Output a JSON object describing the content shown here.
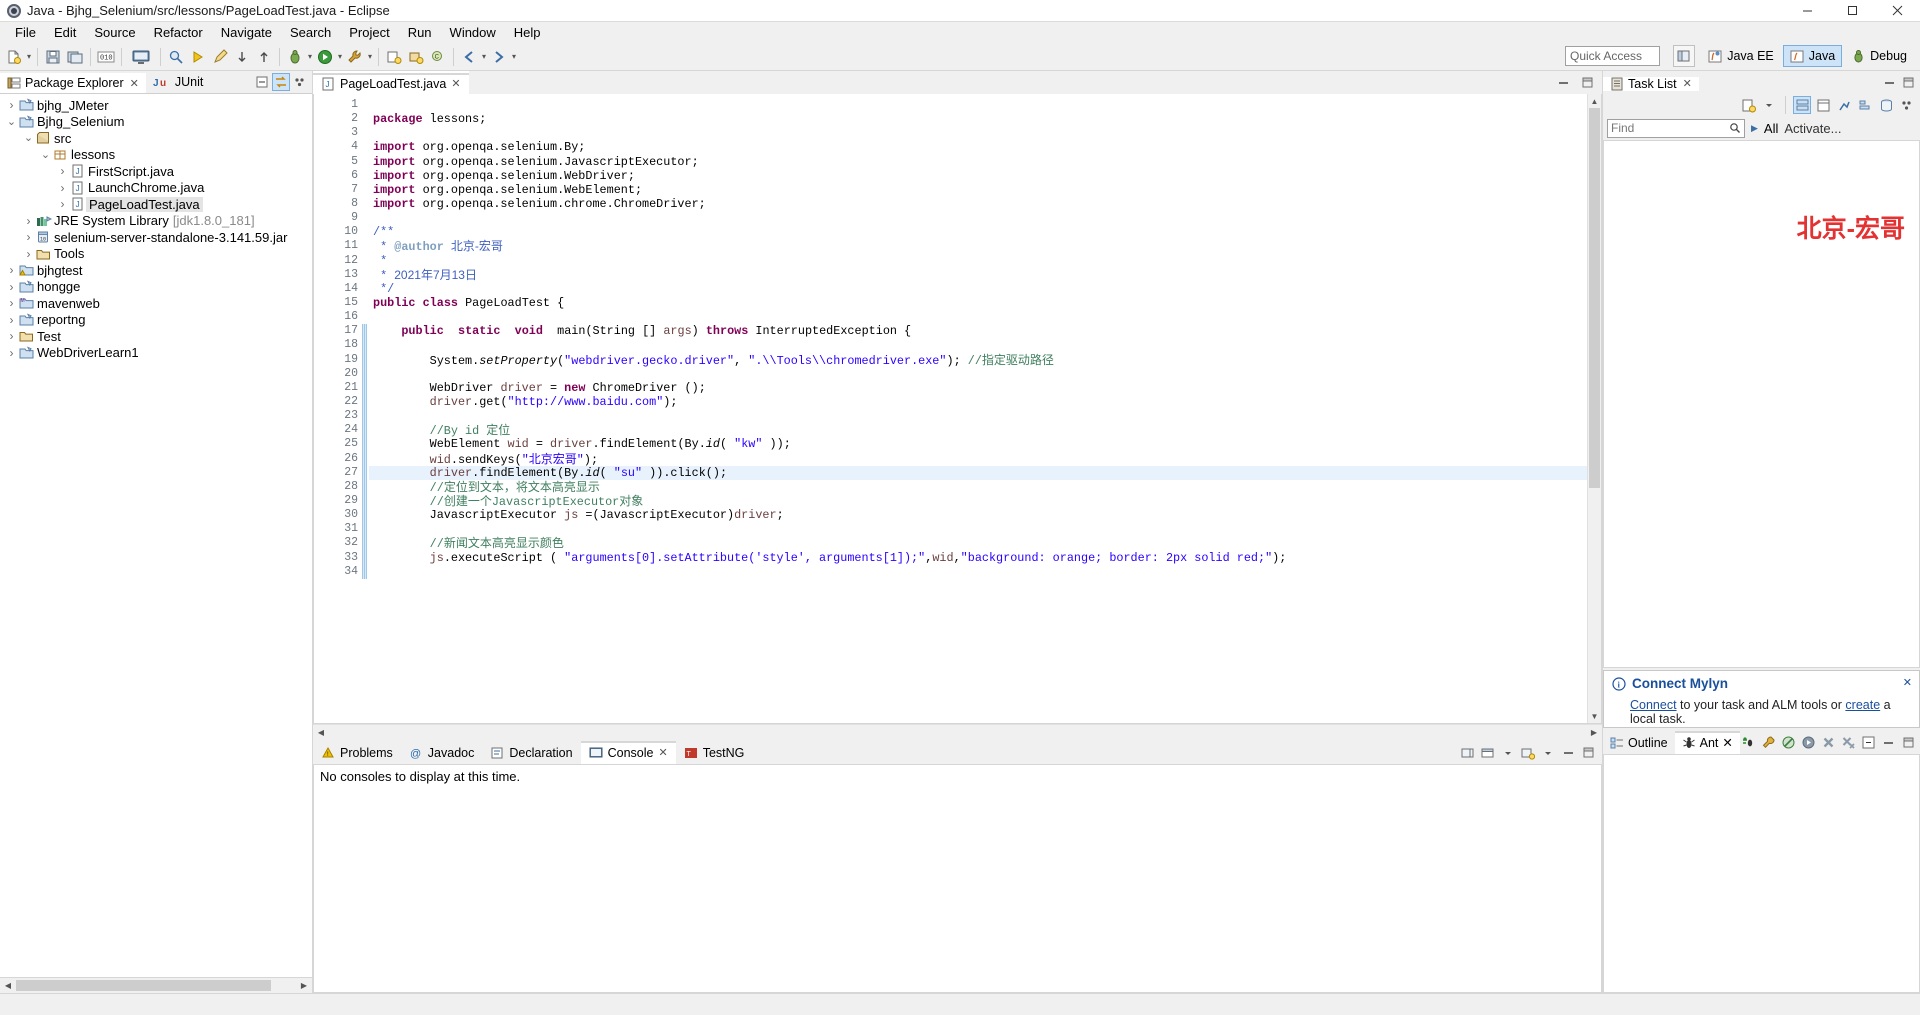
{
  "window": {
    "title": "Java - Bjhg_Selenium/src/lessons/PageLoadTest.java - Eclipse",
    "minimize": "—",
    "maximize": "□",
    "close": "✕"
  },
  "menu": [
    "File",
    "Edit",
    "Source",
    "Refactor",
    "Navigate",
    "Search",
    "Project",
    "Run",
    "Window",
    "Help"
  ],
  "toolbar": {
    "quick_access_placeholder": "Quick Access",
    "perspectives": [
      {
        "label": "Java EE",
        "active": false
      },
      {
        "label": "Java",
        "active": true
      },
      {
        "label": "Debug",
        "active": false
      }
    ]
  },
  "left_panel": {
    "tabs": [
      {
        "label": "Package Explorer",
        "active": true,
        "closable": true
      },
      {
        "label": "JUnit",
        "active": false,
        "closable": false
      }
    ],
    "tree": [
      {
        "label": "bjhg_JMeter",
        "depth": 0,
        "arrow": "collapsed",
        "icon": "project-icon",
        "selected": false
      },
      {
        "label": "Bjhg_Selenium",
        "depth": 0,
        "arrow": "expanded",
        "icon": "project-icon",
        "selected": false
      },
      {
        "label": "src",
        "depth": 1,
        "arrow": "expanded",
        "icon": "source-folder-icon",
        "selected": false
      },
      {
        "label": "lessons",
        "depth": 2,
        "arrow": "expanded",
        "icon": "package-icon",
        "selected": false
      },
      {
        "label": "FirstScript.java",
        "depth": 3,
        "arrow": "collapsed",
        "icon": "java-file-icon",
        "selected": false
      },
      {
        "label": "LaunchChrome.java",
        "depth": 3,
        "arrow": "collapsed",
        "icon": "java-file-icon",
        "selected": false
      },
      {
        "label": "PageLoadTest.java",
        "depth": 3,
        "arrow": "collapsed",
        "icon": "java-file-icon",
        "selected": true
      },
      {
        "label": "JRE System Library",
        "suffix": "[jdk1.8.0_181]",
        "depth": 1,
        "arrow": "collapsed",
        "icon": "library-icon",
        "selected": false
      },
      {
        "label": "selenium-server-standalone-3.141.59.jar",
        "depth": 1,
        "arrow": "collapsed",
        "icon": "jar-icon",
        "selected": false
      },
      {
        "label": "Tools",
        "depth": 1,
        "arrow": "collapsed",
        "icon": "folder-icon",
        "selected": false
      },
      {
        "label": "bjhgtest",
        "depth": 0,
        "arrow": "collapsed",
        "icon": "project-warning-icon",
        "selected": false
      },
      {
        "label": "hongge",
        "depth": 0,
        "arrow": "collapsed",
        "icon": "project-icon",
        "selected": false
      },
      {
        "label": "mavenweb",
        "depth": 0,
        "arrow": "collapsed",
        "icon": "maven-project-icon",
        "selected": false
      },
      {
        "label": "reportng",
        "depth": 0,
        "arrow": "collapsed",
        "icon": "project-icon",
        "selected": false
      },
      {
        "label": "Test",
        "depth": 0,
        "arrow": "collapsed",
        "icon": "folder-icon",
        "selected": false
      },
      {
        "label": "WebDriverLearn1",
        "depth": 0,
        "arrow": "collapsed",
        "icon": "project-icon",
        "selected": false
      }
    ]
  },
  "editor": {
    "tab": {
      "label": "PageLoadTest.java",
      "close": "✕"
    },
    "lines": [
      {
        "n": 1,
        "html": ""
      },
      {
        "n": 2,
        "html": "<span class=\"kw\">package</span> lessons;"
      },
      {
        "n": 3,
        "html": ""
      },
      {
        "n": 4,
        "html": "<span class=\"kw\">import</span> org.openqa.selenium.By;",
        "fold": true
      },
      {
        "n": 5,
        "html": "<span class=\"kw\">import</span> org.openqa.selenium.JavascriptExecutor;"
      },
      {
        "n": 6,
        "html": "<span class=\"kw\">import</span> org.openqa.selenium.WebDriver;"
      },
      {
        "n": 7,
        "html": "<span class=\"kw\">import</span> org.openqa.selenium.WebElement;"
      },
      {
        "n": 8,
        "html": "<span class=\"kw\">import</span> org.openqa.selenium.chrome.ChromeDriver;"
      },
      {
        "n": 9,
        "html": ""
      },
      {
        "n": 10,
        "html": "<span class=\"jdoc\">/**</span>",
        "fold": true
      },
      {
        "n": 11,
        "html": "<span class=\"jdoc\"> * </span><span class=\"jdoc-tag\">@author</span><span class=\"jdoc\"> <span class=\"cn\">北京-宏哥</span></span>"
      },
      {
        "n": 12,
        "html": "<span class=\"jdoc\"> * </span>"
      },
      {
        "n": 13,
        "html": "<span class=\"jdoc\"> * <span class=\"cn\">2021年7月13日</span></span>"
      },
      {
        "n": 14,
        "html": "<span class=\"jdoc\"> */</span>"
      },
      {
        "n": 15,
        "html": "<span class=\"kw\">public</span> <span class=\"kw\">class</span> PageLoadTest {"
      },
      {
        "n": 16,
        "html": ""
      },
      {
        "n": 17,
        "html": "    <span class=\"kw\">public</span>  <span class=\"kw\">static</span>  <span class=\"kw\">void</span>  main(String [] <span class=\"prm\">args</span>) <span class=\"kw\">throws</span> InterruptedException {",
        "fold": true,
        "changed": true
      },
      {
        "n": 18,
        "html": "",
        "changed": true
      },
      {
        "n": 19,
        "html": "        System.<span class=\"stat\">setProperty</span>(<span class=\"str\">\"webdriver.gecko.driver\"</span>, <span class=\"str\">\".\\\\Tools\\\\chromedriver.exe\"</span>); <span class=\"cmt\">//<span class=\"cn\">指定驱动路径</span></span>",
        "changed": true
      },
      {
        "n": 20,
        "html": "",
        "changed": true
      },
      {
        "n": 21,
        "html": "        WebDriver <span class=\"prm\">driver</span> = <span class=\"kw\">new</span> ChromeDriver ();",
        "changed": true
      },
      {
        "n": 22,
        "html": "        <span class=\"prm\">driver</span>.get(<span class=\"str\">\"http://www.baidu.com\"</span>);",
        "changed": true
      },
      {
        "n": 23,
        "html": "",
        "changed": true
      },
      {
        "n": 24,
        "html": "        <span class=\"cmt\">//By id <span class=\"cn\">定位</span></span>",
        "changed": true
      },
      {
        "n": 25,
        "html": "        WebElement <span class=\"prm\">wid</span> = <span class=\"prm\">driver</span>.findElement(By.<span class=\"stat\">id</span>( <span class=\"str\">\"kw\"</span> ));",
        "changed": true
      },
      {
        "n": 26,
        "html": "        <span class=\"prm\">wid</span>.sendKeys(<span class=\"str\">\"<span class=\"cn\">北京宏哥</span>\"</span>);",
        "changed": true
      },
      {
        "n": 27,
        "html": "        <span class=\"prm\">driver</span>.findElement(By.<span class=\"stat\">id</span>( <span class=\"str\">\"su\"</span> )).click();",
        "changed": true,
        "highlight": true
      },
      {
        "n": 28,
        "html": "        <span class=\"cmt\">//<span class=\"cn\">定位到文本，将文本高亮显示</span></span>",
        "changed": true
      },
      {
        "n": 29,
        "html": "        <span class=\"cmt\">//<span class=\"cn\">创建一个</span>JavascriptExecutor<span class=\"cn\">对象</span></span>",
        "changed": true
      },
      {
        "n": 30,
        "html": "        JavascriptExecutor <span class=\"prm\">js</span> =(JavascriptExecutor)<span class=\"prm\">driver</span>;",
        "changed": true
      },
      {
        "n": 31,
        "html": "",
        "changed": true
      },
      {
        "n": 32,
        "html": "        <span class=\"cmt\">//<span class=\"cn\">新闻文本高亮显示颜色</span></span>",
        "changed": true
      },
      {
        "n": 33,
        "html": "        <span class=\"prm\">js</span>.executeScript ( <span class=\"str\">\"arguments[0].setAttribute('style', arguments[1]);\"</span>,<span class=\"prm\">wid</span>,<span class=\"str\">\"background: orange; border: 2px solid red;\"</span>);",
        "changed": true
      },
      {
        "n": 34,
        "html": "",
        "changed": true
      }
    ]
  },
  "bottom_panel": {
    "tabs": [
      {
        "label": "Problems",
        "icon": "problems-icon",
        "active": false,
        "closable": false
      },
      {
        "label": "Javadoc",
        "icon": "javadoc-icon",
        "active": false,
        "closable": false
      },
      {
        "label": "Declaration",
        "icon": "declaration-icon",
        "active": false,
        "closable": false
      },
      {
        "label": "Console",
        "icon": "console-icon",
        "active": true,
        "closable": true
      },
      {
        "label": "TestNG",
        "icon": "testng-icon",
        "active": false,
        "closable": false
      }
    ],
    "console_message": "No consoles to display at this time."
  },
  "right_panel": {
    "task_list": {
      "title": "Task List",
      "close": "✕",
      "find_placeholder": "Find",
      "all_label": "All",
      "activate_label": "Activate...",
      "watermark": "北京-宏哥"
    },
    "mylyn": {
      "title": "Connect Mylyn",
      "text_before": "Connect",
      "link1": "Connect",
      "text_middle": " to your task and ALM tools or ",
      "link2": "create",
      "text_after": " a local task.",
      "close": "✕"
    },
    "outline": {
      "tabs": [
        {
          "label": "Outline",
          "active": false,
          "closable": false
        },
        {
          "label": "Ant",
          "active": true,
          "closable": true
        }
      ]
    }
  },
  "colors": {
    "accent": "#cde3f7",
    "link": "#1a4f9c",
    "watermark": "#e33232",
    "keyword": "#7f0055",
    "string": "#2a00ff",
    "comment": "#3f7f5f",
    "javadoc": "#3f5fbf"
  }
}
